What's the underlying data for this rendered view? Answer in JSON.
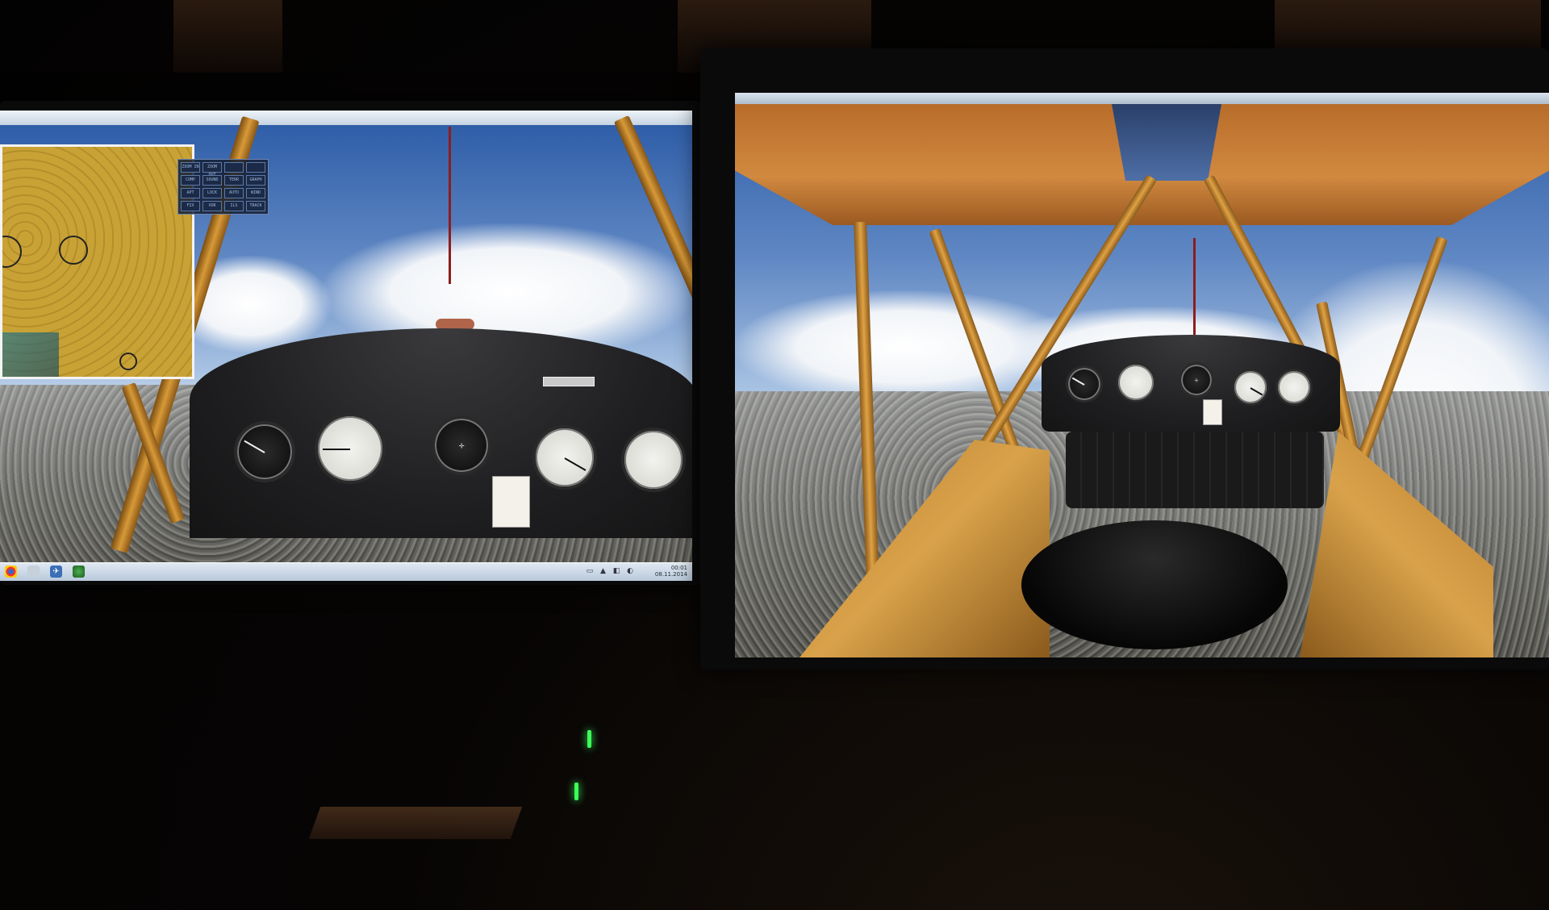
{
  "scene": {
    "left_monitor": {
      "app": "flight-simulator",
      "gauges": [
        "airspeed-indicator",
        "altimeter",
        "magnetic-compass",
        "tachometer",
        "oil-gauge"
      ],
      "nameplate_text": "",
      "taskbar": {
        "icons": [
          "chrome-icon",
          "app-icon",
          "flight-sim-icon",
          "browser-icon"
        ],
        "clock_time": "00:01",
        "clock_date": "08.11.2014"
      },
      "map_window": {
        "type": "sectional-chart"
      },
      "control_panel": {
        "buttons": [
          "ZOOM IN",
          "ZOOM OUT",
          "",
          "",
          "COMP",
          "SOUND",
          "TERR",
          "GRAPH",
          "APT",
          "LOCK",
          "AUTO",
          "WIND",
          "FIX",
          "VOR",
          "ILS",
          "TRACK"
        ]
      }
    },
    "right_monitor": {
      "app": "flight-simulator",
      "view": "cockpit-wide",
      "gauges": [
        "airspeed-indicator",
        "altimeter",
        "magnetic-compass",
        "tachometer",
        "oil-gauge"
      ]
    },
    "colors": {
      "frame_orange": "#d89a38",
      "sky_blue": "#5f87c3",
      "dash_black": "#1f1f21",
      "led_green": "#3cff5a"
    }
  }
}
